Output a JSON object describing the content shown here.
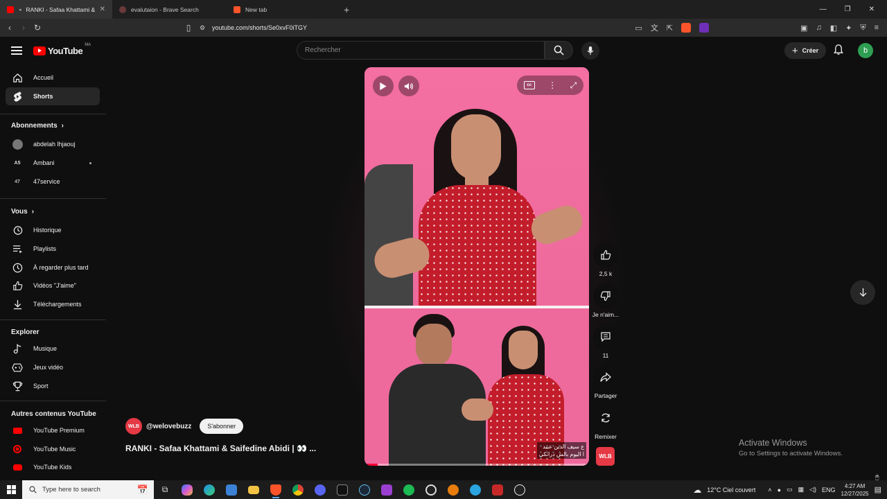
{
  "browser": {
    "tabs": [
      {
        "title": "RANKI - Safaa Khattami & Sai",
        "active": true
      },
      {
        "title": "evalutaion - Brave Search",
        "active": false
      },
      {
        "title": "New tab",
        "active": false
      }
    ],
    "url": "youtube.com/shorts/Se0xvF0iTGY"
  },
  "header": {
    "logo_text": "YouTube",
    "country_code": "MA",
    "search_placeholder": "Rechercher",
    "create_label": "Créer",
    "avatar_letter": "b"
  },
  "sidebar": {
    "main": [
      {
        "label": "Accueil",
        "icon": "home-icon"
      },
      {
        "label": "Shorts",
        "icon": "shorts-icon",
        "active": true
      }
    ],
    "subscriptions_heading": "Abonnements",
    "subscriptions": [
      {
        "label": "abdelah lhjaouj"
      },
      {
        "label": "Ambani"
      },
      {
        "label": "47service"
      }
    ],
    "you_heading": "Vous",
    "you": [
      {
        "label": "Historique",
        "icon": "history-icon"
      },
      {
        "label": "Playlists",
        "icon": "playlists-icon"
      },
      {
        "label": "À regarder plus tard",
        "icon": "watch-later-icon"
      },
      {
        "label": "Vidéos \"J'aime\"",
        "icon": "liked-icon"
      },
      {
        "label": "Téléchargements",
        "icon": "download-icon"
      }
    ],
    "explore_heading": "Explorer",
    "explore": [
      {
        "label": "Musique",
        "icon": "music-icon"
      },
      {
        "label": "Jeux vidéo",
        "icon": "gaming-icon"
      },
      {
        "label": "Sport",
        "icon": "trophy-icon"
      }
    ],
    "more_heading": "Autres contenus YouTube",
    "more": [
      {
        "label": "YouTube Premium"
      },
      {
        "label": "YouTube Music"
      },
      {
        "label": "YouTube Kids"
      }
    ]
  },
  "short": {
    "caption_line1": "ع سيف الدين عبيد",
    "caption_line2": "ا اليوم بالش درانكي",
    "progress": 0.06
  },
  "actions": {
    "likes": "2,5 k",
    "dislike_label": "Je n'aim...",
    "comments": "11",
    "share_label": "Partager",
    "remix_label": "Remixer",
    "channel_badge": "WLB"
  },
  "channel": {
    "avatar_text": "WLB",
    "handle": "@welovebuzz",
    "subscribe_label": "S'abonner",
    "title": "RANKI - Safaa Khattami & Saifedine Abidi | 👀 ..."
  },
  "watermark": {
    "line1": "Activate Windows",
    "line2": "Go to Settings to activate Windows."
  },
  "taskbar": {
    "search_placeholder": "Type here to search",
    "weather": "12°C  Ciel couvert",
    "lang": "ENG",
    "time": "4:27 AM",
    "date": "12/27/2025"
  }
}
